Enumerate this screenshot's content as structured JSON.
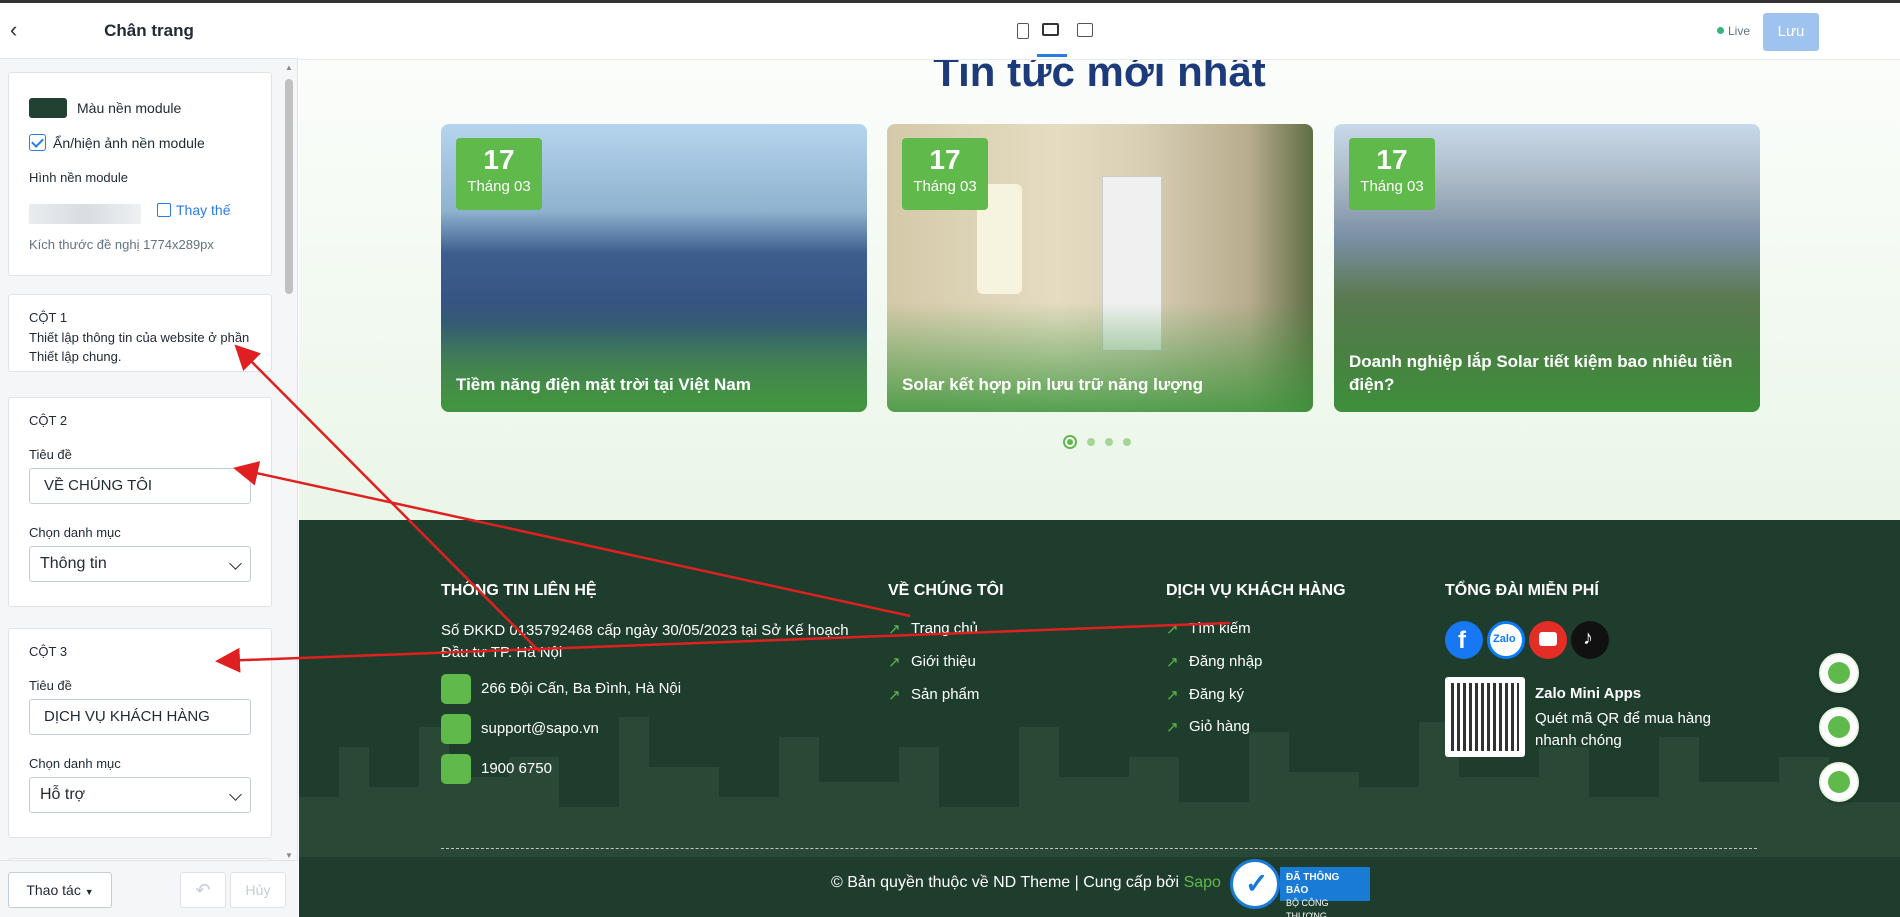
{
  "sidebar": {
    "title": "Chân trang",
    "bg_module": {
      "color_label": "Màu nền module",
      "swatch_color": "#214232",
      "toggle_label": "Ẩn/hiện ảnh nền module",
      "image_label": "Hình nền module",
      "replace_label": "Thay thế",
      "size_hint": "Kích thước đề nghị 1774x289px"
    },
    "col1": {
      "title": "CỘT 1",
      "desc": "Thiết lập thông tin của website ở phần Thiết lập chung."
    },
    "col2": {
      "title": "CỘT 2",
      "heading_label": "Tiêu đề",
      "heading_value": "VỀ CHÚNG TÔI",
      "category_label": "Chọn danh mục",
      "category_value": "Thông tin"
    },
    "col3": {
      "title": "CỘT 3",
      "heading_label": "Tiêu đề",
      "heading_value": "DỊCH VỤ KHÁCH HÀNG",
      "category_label": "Chọn danh mục",
      "category_value": "Hỗ trợ"
    },
    "footer": {
      "actions_label": "Thao tác",
      "cancel_label": "Hủy"
    }
  },
  "topbar": {
    "live_label": "Live",
    "save_label": "Lưu",
    "active_device": "desktop"
  },
  "preview": {
    "news_title": "Tin tức mới nhất",
    "cards": [
      {
        "day": "17",
        "month": "Tháng 03",
        "caption": "Tiềm năng điện mặt trời tại Việt Nam"
      },
      {
        "day": "17",
        "month": "Tháng 03",
        "caption": "Solar kết hợp pin lưu trữ năng lượng"
      },
      {
        "day": "17",
        "month": "Tháng 03",
        "caption": "Doanh nghiệp lắp Solar tiết kiệm bao nhiêu tiền điện?"
      }
    ],
    "pagination": {
      "active": 1,
      "total": 4
    },
    "footer": {
      "contact": {
        "title": "THÔNG TIN LIÊN HỆ",
        "registration": "Số ĐKKD 0135792468 cấp ngày 30/05/2023 tại Sở Kế hoạch Đầu tư TP. Hà Nội",
        "address": "266 Đội Cấn, Ba Đình, Hà Nội",
        "email": "support@sapo.vn",
        "phone": "1900 6750"
      },
      "about": {
        "title": "VỀ CHÚNG TÔI",
        "links": [
          "Trang chủ",
          "Giới thiệu",
          "Sản phẩm"
        ]
      },
      "service": {
        "title": "DỊCH VỤ KHÁCH HÀNG",
        "links": [
          "Tìm kiếm",
          "Đăng nhập",
          "Đăng ký",
          "Giỏ hàng"
        ]
      },
      "hotline": {
        "title": "TỔNG ĐÀI MIỄN PHÍ",
        "social": [
          "facebook-icon",
          "zalo-icon",
          "youtube-icon",
          "tiktok-icon"
        ],
        "zalo_label": "Zalo",
        "mini_app_title": "Zalo Mini Apps",
        "mini_app_desc": "Quét mã QR để mua hàng nhanh chóng"
      },
      "copyright_prefix": "© Bản quyền thuộc về ND Theme | Cung cấp bởi",
      "copyright_brand": "Sapo",
      "badge_line1": "ĐÃ THÔNG BÁO",
      "badge_line2": "BỘ CÔNG THƯƠNG"
    },
    "accent_color": "#5fb94b",
    "footer_bg": "#1f3d2c"
  }
}
